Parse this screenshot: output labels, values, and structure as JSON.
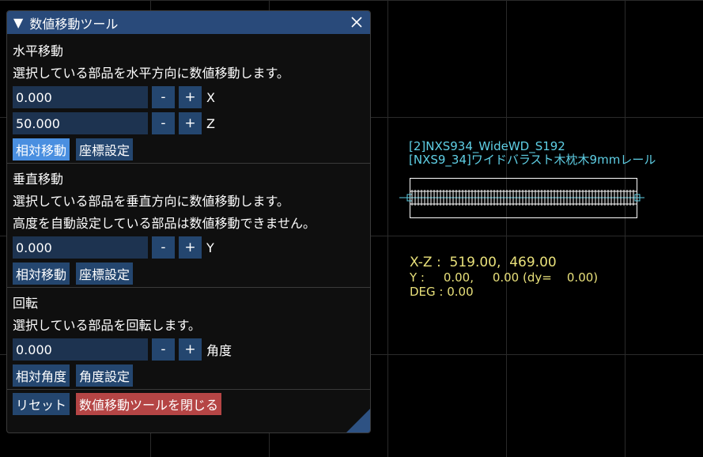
{
  "window": {
    "title": "数値移動ツール",
    "collapse_glyph": "▼",
    "close_icon": "close-icon"
  },
  "horizontal": {
    "title": "水平移動",
    "description": "選択している部品を水平方向に数値移動します。",
    "x_value": "0.000",
    "x_label": "X",
    "z_value": "50.000",
    "z_label": "Z",
    "relative_label": "相対移動",
    "coord_label": "座標設定"
  },
  "vertical": {
    "title": "垂直移動",
    "description": "選択している部品を垂直方向に数値移動します。",
    "note": "高度を自動設定している部品は数値移動できません。",
    "y_value": "0.000",
    "y_label": "Y",
    "relative_label": "相対移動",
    "coord_label": "座標設定"
  },
  "rotation": {
    "title": "回転",
    "description": "選択している部品を回転します。",
    "angle_value": "0.000",
    "angle_label": "角度",
    "relative_label": "相対角度",
    "set_label": "角度設定"
  },
  "stepper": {
    "minus": "-",
    "plus": "+"
  },
  "footer": {
    "reset_label": "リセット",
    "close_tool_label": "数値移動ツールを閉じる"
  },
  "canvas": {
    "part_line1": "[2]NXS934_WideWD_S192",
    "part_line2": "[NXS9_34]ワイドバラスト木枕木9mmレール",
    "coord_xz": "X-Z :  519.00,  469.00",
    "coord_y": "Y :     0.00,     0.00 (dy=    0.00)",
    "coord_deg": "DEG : 0.00"
  },
  "colors": {
    "title_bar": "#294a7a",
    "button": "#24466f",
    "button_active": "#4a8fe0",
    "button_danger": "#b54545",
    "input_bg": "#1d3350",
    "annotation_cyan": "#5fd0e6",
    "annotation_yellow": "#e8e07a"
  }
}
